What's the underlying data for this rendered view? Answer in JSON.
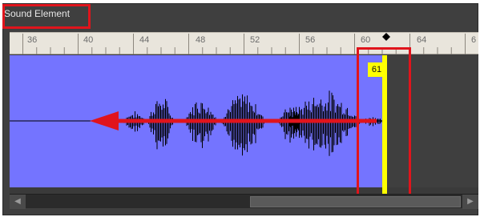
{
  "panel": {
    "title": "Sound Element"
  },
  "ruler": {
    "labels": [
      "36",
      "40",
      "44",
      "48",
      "52",
      "56",
      "60",
      "64",
      "6"
    ]
  },
  "playhead": {
    "frame": "61",
    "color": "#ffff00"
  },
  "track": {
    "waveform_color": "#000000",
    "background_color": "#7474ff"
  },
  "annotations": {
    "highlight_color": "#e0141c",
    "arrow_direction": "left"
  },
  "scrollbar": {
    "left_arrow": "◀",
    "right_arrow": "▶"
  }
}
